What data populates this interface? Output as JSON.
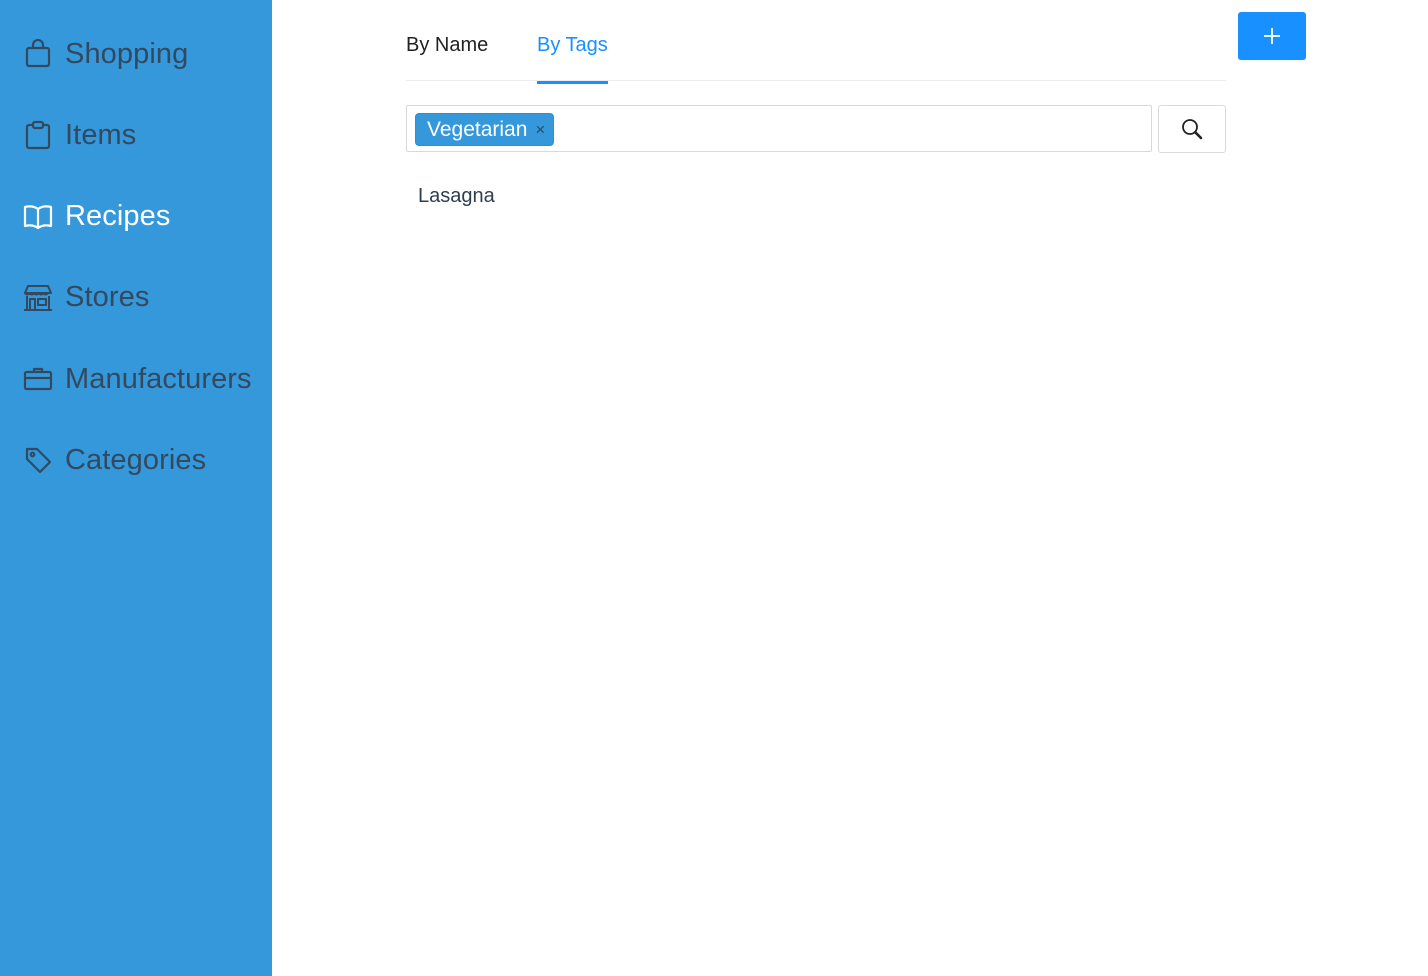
{
  "sidebar": {
    "items": [
      {
        "label": "Shopping",
        "icon": "shopping-bag-icon",
        "active": false
      },
      {
        "label": "Items",
        "icon": "clipboard-icon",
        "active": false
      },
      {
        "label": "Recipes",
        "icon": "book-icon",
        "active": true
      },
      {
        "label": "Stores",
        "icon": "store-icon",
        "active": false
      },
      {
        "label": "Manufacturers",
        "icon": "briefcase-icon",
        "active": false
      },
      {
        "label": "Categories",
        "icon": "tag-icon",
        "active": false
      }
    ]
  },
  "tabs": [
    {
      "label": "By Name",
      "active": false
    },
    {
      "label": "By Tags",
      "active": true
    }
  ],
  "toolbar": {
    "add_icon": "plus-icon",
    "search_icon": "search-icon"
  },
  "tag_filter": {
    "selected_tags": [
      {
        "label": "Vegetarian",
        "close_symbol": "×"
      }
    ]
  },
  "results": [
    {
      "name": "Lasagna"
    }
  ],
  "colors": {
    "sidebar_bg": "#3498db",
    "sidebar_text": "#34495e",
    "sidebar_active_text": "#ffffff",
    "accent": "#1890ff",
    "tag_bg": "#3498db"
  }
}
